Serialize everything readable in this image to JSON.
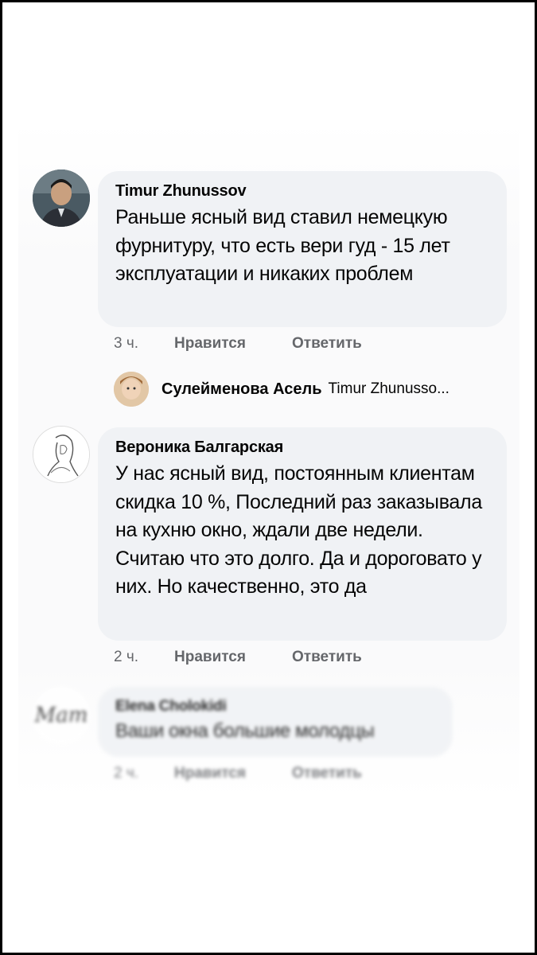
{
  "comments": [
    {
      "author": "Timur Zhunussov",
      "text": "Раньше ясный вид ставил немецкую фурнитуру, что есть вери гуд - 15 лет эксплуатации и никаких проблем",
      "time": "3 ч.",
      "like": "Нравится",
      "reply": "Ответить",
      "avatar_icon": "man-portrait-avatar"
    },
    {
      "author": "Вероника Балгарская",
      "text": "У нас ясный вид, постоянным клиентам скидка 10 %, Последний раз заказывала на кухню окно, ждали две недели. Считаю что это долго. Да и дороговато у них. Но качественно, это да",
      "time": "2 ч.",
      "like": "Нравится",
      "reply": "Ответить",
      "avatar_icon": "woman-sketch-avatar"
    },
    {
      "author": "Elena Cholokidi",
      "text": "Ваши окна большие молодцы",
      "time": "2 ч.",
      "like": "Нравится",
      "reply": "Ответить",
      "avatar_icon": "script-logo-avatar",
      "avatar_text": "Mam"
    }
  ],
  "reply_preview": {
    "author": "Сулейменова Асель",
    "text": "Timur Zhunusso...",
    "avatar_icon": "child-photo-avatar"
  },
  "colors": {
    "bubble": "#f0f2f5",
    "meta": "#65676b",
    "text": "#050505"
  }
}
